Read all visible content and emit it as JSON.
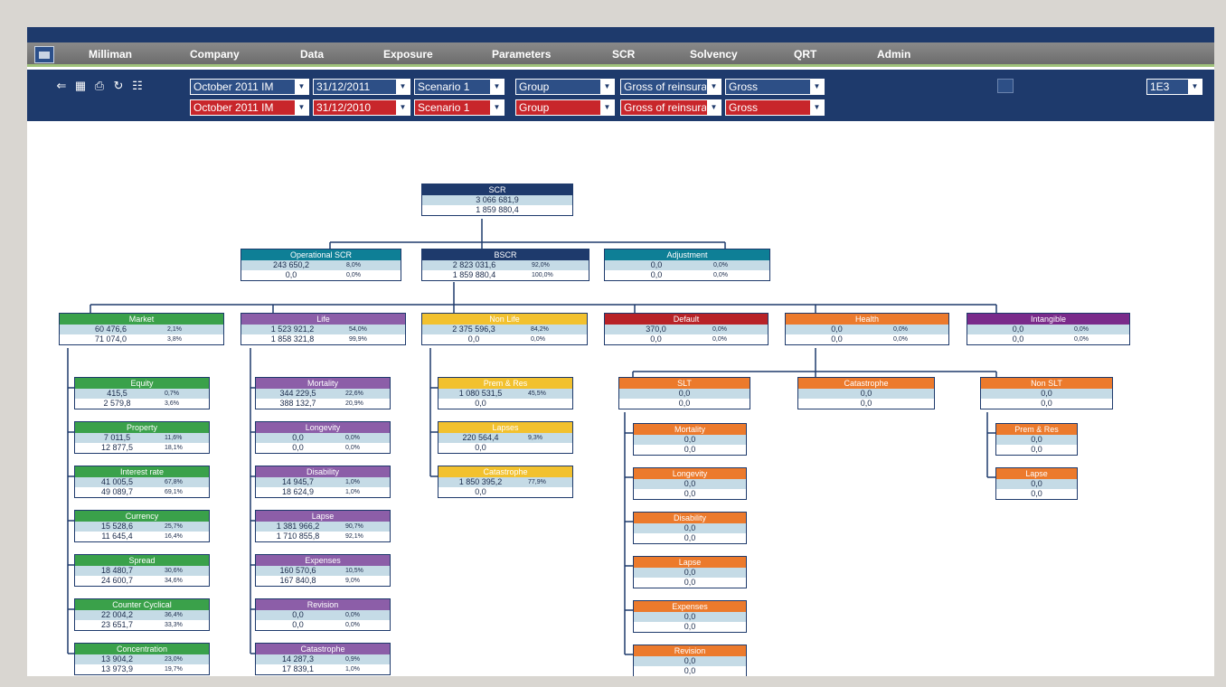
{
  "menu": {
    "items": [
      "Milliman",
      "Company",
      "Data",
      "Exposure",
      "Parameters",
      "SCR",
      "Solvency",
      "QRT",
      "Admin"
    ]
  },
  "toolbar": {
    "tools": [
      "back-arrow-icon",
      "chart-icon",
      "print-icon",
      "refresh-icon",
      "hierarchy-icon"
    ],
    "current": {
      "study": "October 2011 IM",
      "date": "31/12/2011",
      "scenario": "Scenario 1",
      "entity": "Group",
      "reinsurance": "Gross of reinsurance",
      "gross": "Gross"
    },
    "reference": {
      "study": "October 2011 IM",
      "date": "31/12/2010",
      "scenario": "Scenario 1",
      "entity": "Group",
      "reinsurance": "Gross of reinsurance",
      "gross": "Gross"
    },
    "unit": "1E3"
  },
  "colors": {
    "navy": "#1e3a6c",
    "teal": "#0e7f96",
    "market": "#3aa14a",
    "life": "#8c5ea8",
    "nonlife": "#f2c12e",
    "default": "#b82227",
    "health": "#ec7a2c",
    "intangible": "#7a2a8a"
  },
  "tree": {
    "scr": {
      "title": "SCR",
      "v1": "3 066 681,9",
      "v2": "1 859 880,4"
    },
    "operational": {
      "title": "Operational SCR",
      "v1": "243 650,2",
      "p1": "8,0%",
      "v2": "0,0",
      "p2": "0,0%"
    },
    "bscr": {
      "title": "BSCR",
      "v1": "2 823 031,6",
      "p1": "92,0%",
      "v2": "1 859 880,4",
      "p2": "100,0%"
    },
    "adjustment": {
      "title": "Adjustment",
      "v1": "0,0",
      "p1": "0,0%",
      "v2": "0,0",
      "p2": "0,0%"
    },
    "market": {
      "title": "Market",
      "v1": "60 476,6",
      "p1": "2,1%",
      "v2": "71 074,0",
      "p2": "3,8%"
    },
    "life": {
      "title": "Life",
      "v1": "1 523 921,2",
      "p1": "54,0%",
      "v2": "1 858 321,8",
      "p2": "99,9%"
    },
    "nonlife": {
      "title": "Non Life",
      "v1": "2 375 596,3",
      "p1": "84,2%",
      "v2": "0,0",
      "p2": "0,0%"
    },
    "default": {
      "title": "Default",
      "v1": "370,0",
      "p1": "0,0%",
      "v2": "0,0",
      "p2": "0,0%"
    },
    "health": {
      "title": "Health",
      "v1": "0,0",
      "p1": "0,0%",
      "v2": "0,0",
      "p2": "0,0%"
    },
    "intangible": {
      "title": "Intangible",
      "v1": "0,0",
      "p1": "0,0%",
      "v2": "0,0",
      "p2": "0,0%"
    },
    "market_children": [
      {
        "title": "Equity",
        "v1": "415,5",
        "p1": "0,7%",
        "v2": "2 579,8",
        "p2": "3,6%"
      },
      {
        "title": "Property",
        "v1": "7 011,5",
        "p1": "11,6%",
        "v2": "12 877,5",
        "p2": "18,1%"
      },
      {
        "title": "Interest rate",
        "v1": "41 005,5",
        "p1": "67,8%",
        "v2": "49 089,7",
        "p2": "69,1%"
      },
      {
        "title": "Currency",
        "v1": "15 528,6",
        "p1": "25,7%",
        "v2": "11 645,4",
        "p2": "16,4%"
      },
      {
        "title": "Spread",
        "v1": "18 480,7",
        "p1": "30,6%",
        "v2": "24 600,7",
        "p2": "34,6%"
      },
      {
        "title": "Counter Cyclical",
        "v1": "22 004,2",
        "p1": "36,4%",
        "v2": "23 651,7",
        "p2": "33,3%"
      },
      {
        "title": "Concentration",
        "v1": "13 904,2",
        "p1": "23,0%",
        "v2": "13 973,9",
        "p2": "19,7%"
      }
    ],
    "life_children": [
      {
        "title": "Mortality",
        "v1": "344 229,5",
        "p1": "22,6%",
        "v2": "388 132,7",
        "p2": "20,9%"
      },
      {
        "title": "Longevity",
        "v1": "0,0",
        "p1": "0,0%",
        "v2": "0,0",
        "p2": "0,0%"
      },
      {
        "title": "Disability",
        "v1": "14 945,7",
        "p1": "1,0%",
        "v2": "18 624,9",
        "p2": "1,0%"
      },
      {
        "title": "Lapse",
        "v1": "1 381 966,2",
        "p1": "90,7%",
        "v2": "1 710 855,8",
        "p2": "92,1%"
      },
      {
        "title": "Expenses",
        "v1": "160 570,6",
        "p1": "10,5%",
        "v2": "167 840,8",
        "p2": "9,0%"
      },
      {
        "title": "Revision",
        "v1": "0,0",
        "p1": "0,0%",
        "v2": "0,0",
        "p2": "0,0%"
      },
      {
        "title": "Catastrophe",
        "v1": "14 287,3",
        "p1": "0,9%",
        "v2": "17 839,1",
        "p2": "1,0%"
      }
    ],
    "nonlife_children": [
      {
        "title": "Prem & Res",
        "v1": "1 080 531,5",
        "p1": "45,5%",
        "v2": "0,0",
        "p2": ""
      },
      {
        "title": "Lapses",
        "v1": "220 564,4",
        "p1": "9,3%",
        "v2": "0,0",
        "p2": ""
      },
      {
        "title": "Catastrophe",
        "v1": "1 850 395,2",
        "p1": "77,9%",
        "v2": "0,0",
        "p2": ""
      }
    ],
    "health_children": [
      {
        "title": "SLT",
        "v1": "0,0",
        "v2": "0,0"
      },
      {
        "title": "Catastrophe",
        "v1": "0,0",
        "v2": "0,0"
      },
      {
        "title": "Non SLT",
        "v1": "0,0",
        "v2": "0,0"
      }
    ],
    "slt_children": [
      {
        "title": "Mortality",
        "v1": "0,0",
        "v2": "0,0"
      },
      {
        "title": "Longevity",
        "v1": "0,0",
        "v2": "0,0"
      },
      {
        "title": "Disability",
        "v1": "0,0",
        "v2": "0,0"
      },
      {
        "title": "Lapse",
        "v1": "0,0",
        "v2": "0,0"
      },
      {
        "title": "Expenses",
        "v1": "0,0",
        "v2": "0,0"
      },
      {
        "title": "Revision",
        "v1": "0,0",
        "v2": "0,0"
      }
    ],
    "nonslt_children": [
      {
        "title": "Prem & Res",
        "v1": "0,0",
        "v2": "0,0"
      },
      {
        "title": "Lapse",
        "v1": "0,0",
        "v2": "0,0"
      }
    ]
  }
}
